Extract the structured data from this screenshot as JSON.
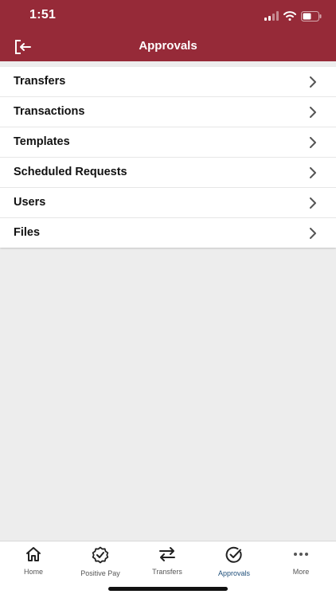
{
  "status": {
    "time": "1:51"
  },
  "header": {
    "title": "Approvals",
    "logout_icon": "logout-icon"
  },
  "menu": {
    "items": [
      {
        "label": "Transfers"
      },
      {
        "label": "Transactions"
      },
      {
        "label": "Templates"
      },
      {
        "label": "Scheduled Requests"
      },
      {
        "label": "Users"
      },
      {
        "label": "Files"
      }
    ]
  },
  "tabs": {
    "items": [
      {
        "label": "Home",
        "icon": "home-icon"
      },
      {
        "label": "Positive Pay",
        "icon": "badge-check-icon"
      },
      {
        "label": "Transfers",
        "icon": "swap-arrows-icon"
      },
      {
        "label": "Approvals",
        "icon": "check-circle-icon",
        "active": true
      },
      {
        "label": "More",
        "icon": "more-dots-icon"
      }
    ]
  },
  "colors": {
    "brand": "#962a38",
    "active_tab": "#1f4f7a",
    "background": "#ededed"
  }
}
